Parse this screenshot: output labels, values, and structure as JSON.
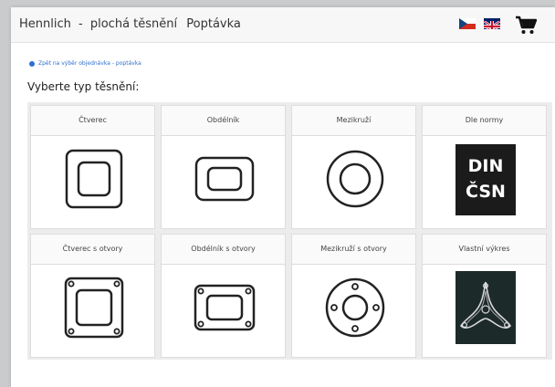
{
  "header": {
    "company": "Hennlich",
    "separator": "-",
    "product": "plochá těsnění",
    "nav_link": "Poptávka"
  },
  "languages": [
    {
      "code": "cs",
      "icon": "czech-flag-icon"
    },
    {
      "code": "en",
      "icon": "uk-flag-icon"
    }
  ],
  "cart": {
    "icon": "shopping-cart-icon"
  },
  "back_link": "Zpět na výběr objednávka - poptávka",
  "page_heading": "Vyberte typ těsnění:",
  "gasket_types": [
    {
      "label": "Čtverec",
      "icon": "square-gasket-icon"
    },
    {
      "label": "Obdélník",
      "icon": "rectangle-gasket-icon"
    },
    {
      "label": "Mezikruží",
      "icon": "ring-gasket-icon"
    },
    {
      "label": "Dle normy",
      "icon": "din-csn-standard-icon",
      "badge_line1": "DIN",
      "badge_line2": "ČSN"
    },
    {
      "label": "Čtverec s otvory",
      "icon": "square-gasket-with-holes-icon"
    },
    {
      "label": "Obdélník s otvory",
      "icon": "rectangle-gasket-with-holes-icon"
    },
    {
      "label": "Mezikruží s otvory",
      "icon": "ring-gasket-with-holes-icon"
    },
    {
      "label": "Vlastní výkres",
      "icon": "custom-drawing-icon"
    }
  ],
  "colors": {
    "link": "#2e6fd0",
    "din_badge": "#1b1b1b",
    "drawing_bg": "#1d2a2a"
  }
}
